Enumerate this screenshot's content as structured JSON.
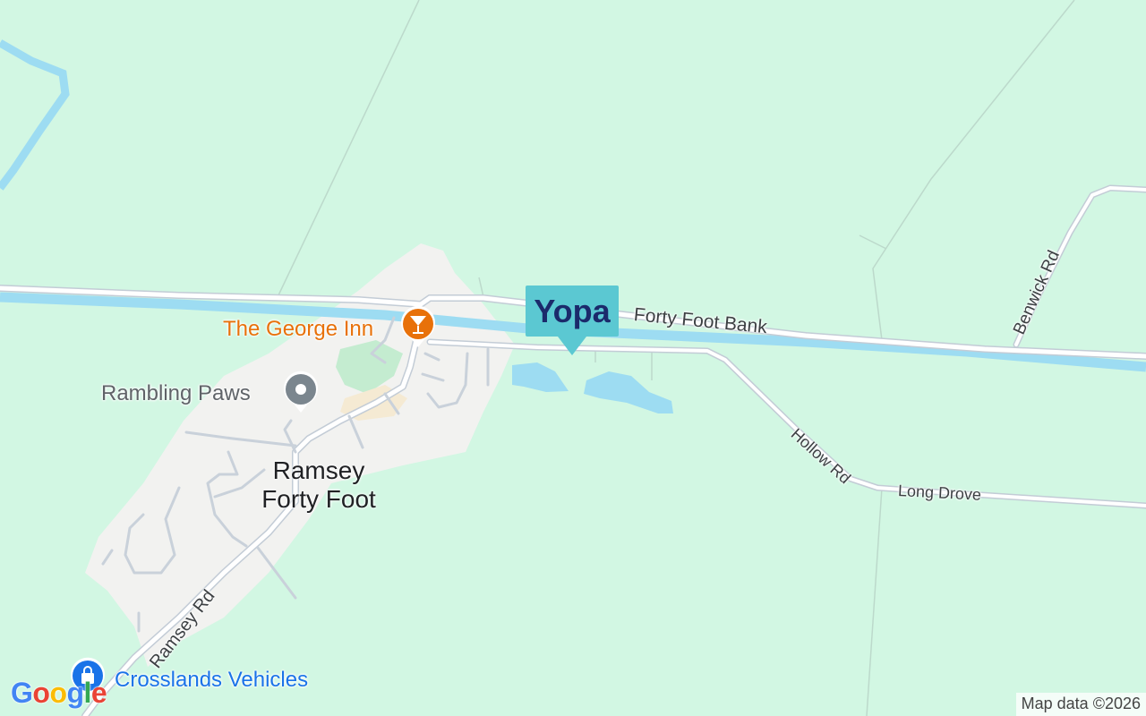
{
  "map": {
    "roads": {
      "forty_foot_bank": "Forty Foot Bank",
      "benwick_rd": "Benwick Rd",
      "hollow_rd": "Hollow Rd",
      "long_drove": "Long Drove",
      "ramsey_rd": "Ramsey Rd"
    },
    "places": {
      "town": "Ramsey Forty Foot",
      "town_line1": "Ramsey",
      "town_line2": "Forty Foot"
    },
    "pois": [
      {
        "name": "The George Inn",
        "icon": "cocktail-icon",
        "color": "#e8710a"
      },
      {
        "name": "Rambling Paws",
        "icon": "pin-icon",
        "color": "#7b868e"
      },
      {
        "name": "Crosslands Vehicles",
        "icon": "shopping-bag-icon",
        "color": "#1a73e8"
      }
    ],
    "brand_marker": {
      "text": "Yopa",
      "display": "Yopa",
      "color": "#5bc8d2",
      "text_color": "#1b2a6b"
    },
    "attribution": "Map data ©2026",
    "logo": "Google",
    "colors": {
      "land": "#d2f7e3",
      "water": "#9ddcf2",
      "town_area": "#f2f2f0",
      "road": "#ffffff",
      "road_casing": "#c3ccd6",
      "park": "#c4ecd0"
    }
  }
}
